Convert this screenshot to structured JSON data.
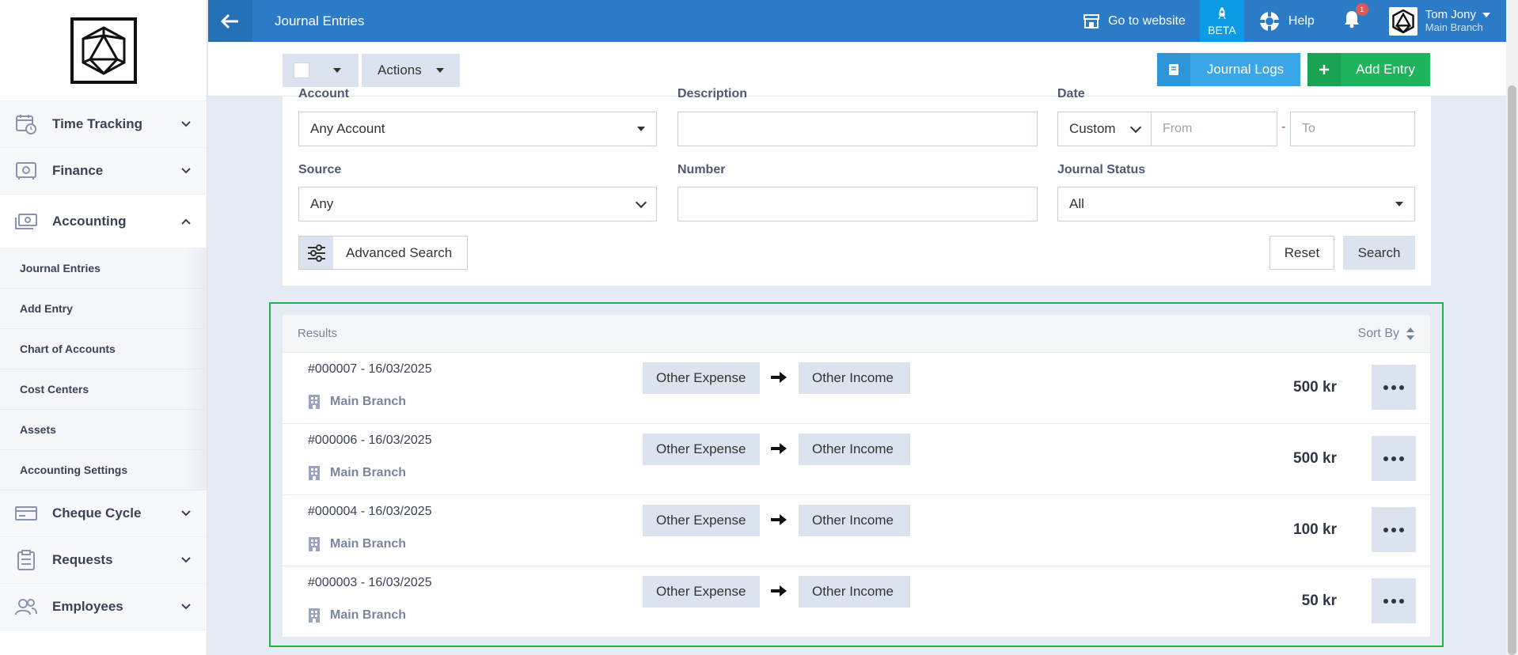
{
  "sidebar": {
    "items": [
      {
        "label": "Time Tracking",
        "icon": "clock-calendar-icon"
      },
      {
        "label": "Finance",
        "icon": "safe-icon"
      },
      {
        "label": "Accounting",
        "icon": "cash-icon"
      },
      {
        "label": "Cheque Cycle",
        "icon": "cheque-icon"
      },
      {
        "label": "Requests",
        "icon": "clipboard-icon"
      },
      {
        "label": "Employees",
        "icon": "people-icon"
      }
    ],
    "accounting_sub": [
      "Journal Entries",
      "Add Entry",
      "Chart of Accounts",
      "Cost Centers",
      "Assets",
      "Accounting Settings"
    ]
  },
  "topbar": {
    "title": "Journal Entries",
    "go_to_website": "Go to website",
    "beta": "BETA",
    "help": "Help",
    "notification_count": "1",
    "user_name": "Tom Jony",
    "user_branch": "Main Branch",
    "accent": "#2c7bc7"
  },
  "toolbar": {
    "actions_label": "Actions",
    "journal_logs_label": "Journal Logs",
    "add_entry_label": "Add Entry"
  },
  "filters": {
    "account_label": "Account",
    "account_value": "Any Account",
    "description_label": "Description",
    "date_label": "Date",
    "date_mode": "Custom",
    "from_placeholder": "From",
    "to_placeholder": "To",
    "date_sep": "-",
    "source_label": "Source",
    "source_value": "Any",
    "number_label": "Number",
    "journal_status_label": "Journal Status",
    "journal_status_value": "All",
    "advanced_search_label": "Advanced Search",
    "reset_label": "Reset",
    "search_label": "Search"
  },
  "results": {
    "title": "Results",
    "sort_label": "Sort By",
    "rows": [
      {
        "number": "#000007 - 16/03/2025",
        "branch": "Main Branch",
        "from": "Other Expense",
        "to": "Other Income",
        "amount": "500 kr"
      },
      {
        "number": "#000006 - 16/03/2025",
        "branch": "Main Branch",
        "from": "Other Expense",
        "to": "Other Income",
        "amount": "500 kr"
      },
      {
        "number": "#000004 - 16/03/2025",
        "branch": "Main Branch",
        "from": "Other Expense",
        "to": "Other Income",
        "amount": "100 kr"
      },
      {
        "number": "#000003 - 16/03/2025",
        "branch": "Main Branch",
        "from": "Other Expense",
        "to": "Other Income",
        "amount": "50 kr"
      }
    ]
  }
}
